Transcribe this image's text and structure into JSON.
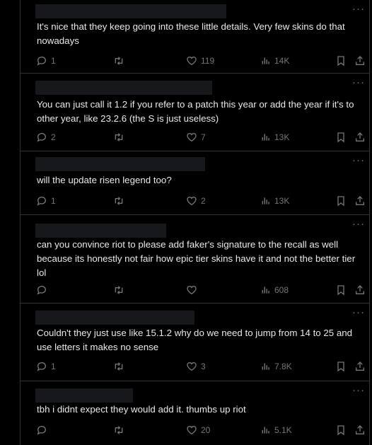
{
  "replies": [
    {
      "text": "It's nice that they keep going into these little details. Very few skins do that nowadays",
      "reply_count": "1",
      "retweet_count": "",
      "like_count": "119",
      "view_count": "14K"
    },
    {
      "text": "You can just call it 1.2 if you refer to a patch this year or add the year if it's to other year, like 23.2.6 (the S is just useless)",
      "reply_count": "2",
      "retweet_count": "",
      "like_count": "7",
      "view_count": "13K"
    },
    {
      "text": "will the update risen legend too?",
      "reply_count": "1",
      "retweet_count": "",
      "like_count": "2",
      "view_count": "13K"
    },
    {
      "text": "can you convince riot to please add faker's signature to the recall as well because its honestly not fair how epic tier skins have it and not the better tier lol",
      "reply_count": "",
      "retweet_count": "",
      "like_count": "",
      "view_count": "608"
    },
    {
      "text": "Couldn't they just use like 15.1.2 why do we need to jump from 14 to 25 and use letters it makes no sense",
      "reply_count": "1",
      "retweet_count": "",
      "like_count": "3",
      "view_count": "7.8K"
    },
    {
      "text": "tbh i didnt expect they would add it. thumbs up riot",
      "reply_count": "",
      "retweet_count": "",
      "like_count": "20",
      "view_count": "5.1K"
    }
  ],
  "icons": {
    "more": "more-icon",
    "reply": "reply-icon",
    "retweet": "retweet-icon",
    "like": "heart-icon",
    "views": "views-icon",
    "bookmark": "bookmark-icon",
    "share": "share-icon"
  },
  "more_glyph": "···",
  "colors": {
    "background": "#000000",
    "text": "#e7e9ea",
    "muted": "#71767b",
    "border": "#2f3336",
    "redacted": "#16181c"
  }
}
